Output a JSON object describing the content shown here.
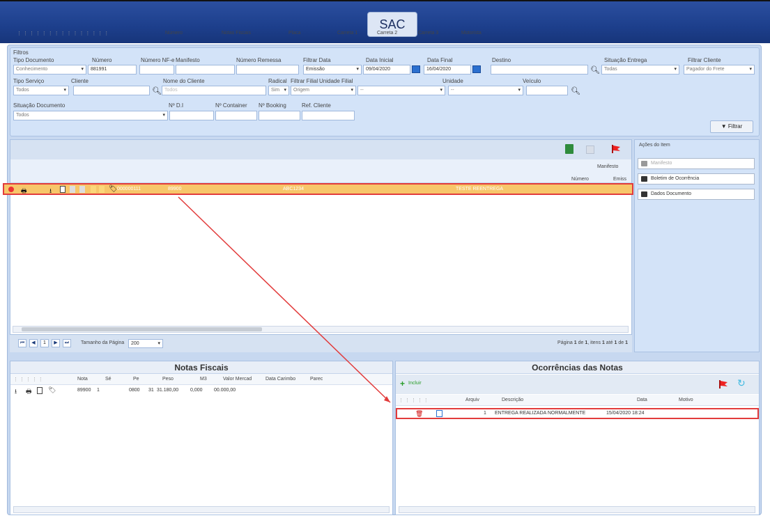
{
  "app": {
    "title": "SAC"
  },
  "filters": {
    "section_label": "Filtros",
    "labels": {
      "tipo_documento": "Tipo Documento",
      "numero": "Número",
      "numero_nfe": "Número NF-e",
      "manifesto": "Manifesto",
      "numero_remessa": "Número Remessa",
      "filtrar_data": "Filtrar Data",
      "data_inicial": "Data Inicial",
      "data_final": "Data Final",
      "destino": "Destino",
      "situacao_entrega": "Situação Entrega",
      "filtrar_cliente": "Filtrar Cliente",
      "tipo_servico": "Tipo Serviço",
      "cliente": "Cliente",
      "nome_cliente": "Nome do Cliente",
      "radical": "Radical",
      "filtrar_filial": "Filtrar Filial",
      "unidade_filial": "Unidade Filial",
      "unidade": "Unidade",
      "veiculo": "Veículo",
      "situacao_documento": "Situação Documento",
      "nro_di": "Nº D.I",
      "nro_container": "Nº Container",
      "nro_booking": "Nº Booking",
      "ref_cliente": "Ref. Cliente"
    },
    "values": {
      "tipo_documento": "Conhecimento",
      "numero": "881991",
      "filtrar_data": "Emissão",
      "data_inicial": "09/04/2020",
      "data_final": "16/04/2020",
      "situacao_entrega": "Todas",
      "filtrar_cliente": "Pagador do Frete",
      "tipo_servico": "Todos",
      "nome_cliente_placeholder": "Todos",
      "radical": "Sim",
      "filtrar_filial": "Origem",
      "filial_sel": "--",
      "unidade_sel": "--",
      "situacao_documento": "Todos"
    },
    "filter_button": "Filtrar"
  },
  "grid": {
    "columns": [
      "Número",
      "Notas Fiscais",
      "Placa",
      "Carreta 1",
      "Carreta 2",
      "Carreta 3",
      "Motorista"
    ],
    "manifesto_group": "Manifesto",
    "manifesto_cols": [
      "Número",
      "Emiss"
    ],
    "row": {
      "numero": "000000111",
      "notas_fiscais": "89900",
      "placa": "ABC1234",
      "motorista": "TESTE REENTREGA"
    },
    "pager": {
      "page_number": "1",
      "page_size_label": "Tamanho da Página",
      "page_size": "200",
      "summary_prefix": "Página",
      "page": "1",
      "of_label": "de",
      "pages": "1",
      "items_label": ", itens",
      "item_from": "1",
      "to_label": "até",
      "item_to": "1",
      "of2_label": "de",
      "total": "1"
    }
  },
  "actions": {
    "title": "Ações do Item",
    "manifesto": "Manifesto",
    "boletim": "Boletim de Ocorrência",
    "dados": "Dados Documento"
  },
  "notas": {
    "title": "Notas Fiscais",
    "columns": [
      "Nota",
      "Sé",
      "Pe",
      "Peso",
      "M3",
      "Valor Mercad",
      "Data Carimbo",
      "Parec"
    ],
    "row": {
      "nota": "89900",
      "serie": "1",
      "c1": "0800",
      "pe": "31",
      "peso": "31.180,00",
      "m3": "0,000",
      "valor": "00.000,00"
    }
  },
  "ocorrencias": {
    "title": "Ocorrências das Notas",
    "add_label": "Incluir",
    "columns": [
      "Arquiv",
      "Descrição",
      "Data",
      "Motivo"
    ],
    "row": {
      "arquiv": "1",
      "descricao": "ENTREGA REALIZADA NORMALMENTE",
      "data": "15/04/2020 18:24"
    }
  },
  "colors": {
    "header_blue": "#1d3f8c",
    "panel_bg": "#c7d8f0",
    "selected_row": "#f7c66a",
    "highlight_red": "#e23b3b"
  }
}
